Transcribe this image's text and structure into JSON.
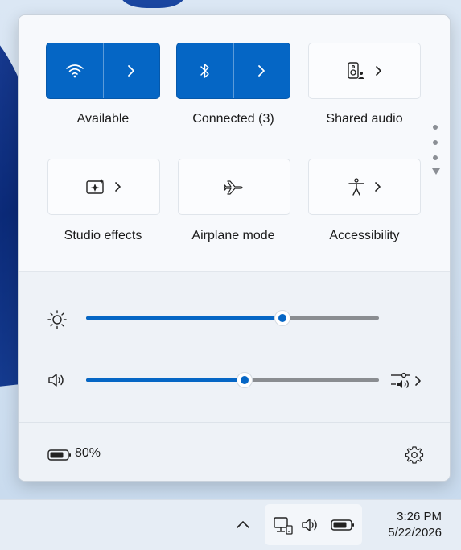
{
  "quick_settings": {
    "tiles": [
      {
        "label": "Available",
        "state": "on",
        "icon": "wifi-icon"
      },
      {
        "label": "Connected (3)",
        "state": "on",
        "icon": "bluetooth-icon"
      },
      {
        "label": "Shared audio",
        "state": "off",
        "icon": "speaker-share-icon"
      },
      {
        "label": "Studio effects",
        "state": "off",
        "icon": "studio-effects-icon"
      },
      {
        "label": "Airplane mode",
        "state": "off",
        "icon": "airplane-icon"
      },
      {
        "label": "Accessibility",
        "state": "off",
        "icon": "accessibility-icon"
      }
    ],
    "brightness": {
      "icon": "sun-icon",
      "value": 0.67
    },
    "volume": {
      "icon": "speaker-icon",
      "value": 0.54
    },
    "battery": {
      "icon": "battery-icon",
      "text": "80%"
    },
    "settings_icon": "gear-icon",
    "colors": {
      "accent": "#0566c5"
    }
  },
  "taskbar": {
    "time": "3:26 PM",
    "date": "5/22/2026",
    "tray_icons": [
      "chevron-up-icon",
      "network-icon",
      "volume-icon",
      "battery-icon"
    ]
  }
}
